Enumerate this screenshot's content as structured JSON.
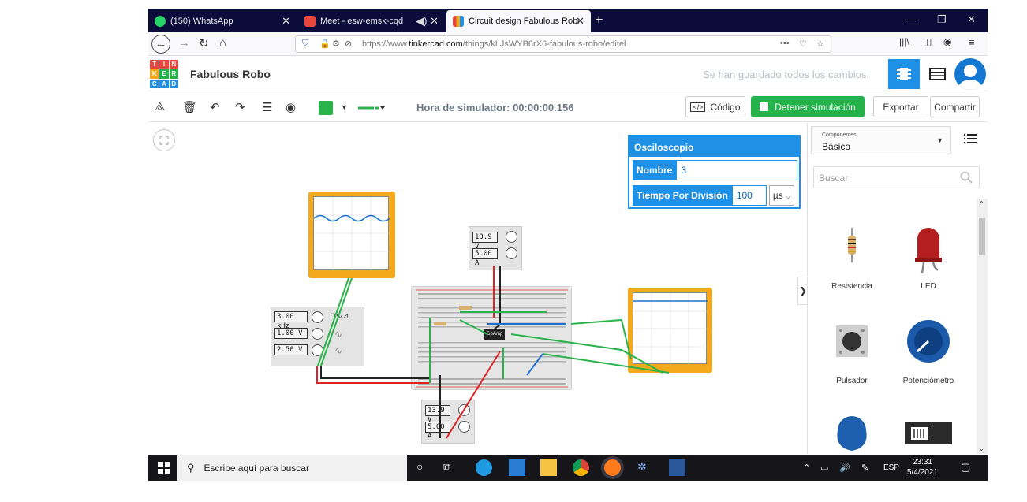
{
  "browser": {
    "tabs": [
      {
        "title": "(150) WhatsApp",
        "active": false
      },
      {
        "title": "Meet - esw-emsk-cqd",
        "active": false
      },
      {
        "title": "Circuit design Fabulous Robo |",
        "active": true
      }
    ],
    "url_prefix": "https://www.",
    "url_domain": "tinkercad.com",
    "url_path": "/things/kLJsWYB6rX6-fabulous-robo/editel"
  },
  "app": {
    "logo_letters": [
      "T",
      "I",
      "N",
      "K",
      "E",
      "R",
      "C",
      "A",
      "D"
    ],
    "project_name": "Fabulous Robo",
    "saved_status": "Se han guardado todos los cambios.",
    "colors": {
      "accent": "#1e90e6",
      "green": "#24b24b",
      "oscilloscope": "#f3a91b",
      "dark_tab": "#0c0c3a"
    }
  },
  "toolbar": {
    "sim_time": "Hora de simulador: 00:00:00.156",
    "code_label": "Código",
    "stop_label": "Detener simulación",
    "export_label": "Exportar",
    "share_label": "Compartir"
  },
  "properties": {
    "title": "Osciloscopio",
    "name_label": "Nombre",
    "name_value": "3",
    "time_label": "Tiempo Por División",
    "time_value": "100",
    "time_unit": "µs"
  },
  "circuit": {
    "supply_top": {
      "voltage": "13.9 V",
      "current": "5.00 A"
    },
    "supply_bottom": {
      "voltage": "13.9 V",
      "current": "5.00 A"
    },
    "function_generator": {
      "frequency": "3.00 kHz",
      "amplitude": "1.00 V",
      "offset": "2.50 V"
    },
    "opamp_label": "OpAmp"
  },
  "sidebar": {
    "selector_caption": "Componentes",
    "selector_value": "Básico",
    "search_placeholder": "Buscar",
    "components": [
      "Resistencia",
      "LED",
      "Pulsador",
      "Potenciómetro"
    ]
  },
  "taskbar": {
    "search_placeholder": "Escribe aquí para buscar",
    "lang": "ESP",
    "time": "23:31",
    "date": "5/4/2021"
  }
}
